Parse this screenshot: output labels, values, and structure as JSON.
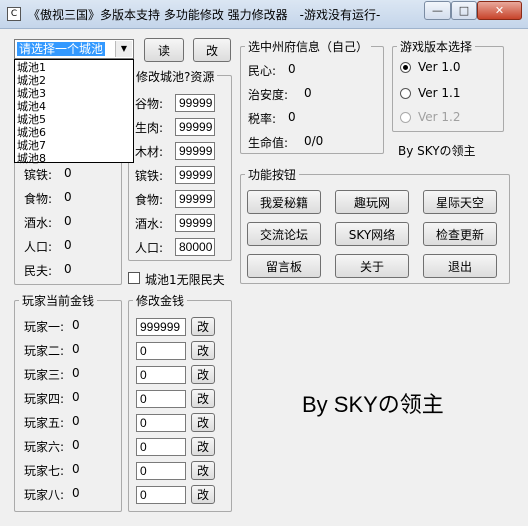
{
  "window": {
    "title": "《傲视三国》多版本支持 多功能修改 强力修改器　-游戏没有运行-",
    "icon_glyph": "C",
    "min": "—",
    "max": "□",
    "close": "✕"
  },
  "city_select": {
    "value": "请选择一个城池",
    "options": [
      "城池1",
      "城池2",
      "城池3",
      "城池4",
      "城池5",
      "城池6",
      "城池7",
      "城池8"
    ]
  },
  "buttons": {
    "read": "读",
    "modify": "改"
  },
  "city_status": {
    "rows": [
      {
        "label": "镔铁:",
        "value": "0"
      },
      {
        "label": "食物:",
        "value": "0"
      },
      {
        "label": "酒水:",
        "value": "0"
      },
      {
        "label": "人口:",
        "value": "0"
      },
      {
        "label": "民夫:",
        "value": "0"
      }
    ]
  },
  "modify_resources": {
    "title": "修改城池?资源",
    "rows": [
      {
        "label": "谷物:",
        "value": "99999"
      },
      {
        "label": "生肉:",
        "value": "99999"
      },
      {
        "label": "木材:",
        "value": "99999"
      },
      {
        "label": "镔铁:",
        "value": "99999"
      },
      {
        "label": "食物:",
        "value": "99999"
      },
      {
        "label": "酒水:",
        "value": "99999"
      },
      {
        "label": "人口:",
        "value": "80000"
      }
    ],
    "unlimited_label": "城池1无限民夫"
  },
  "prefecture": {
    "title": "选中州府信息（自己）",
    "rows": [
      {
        "label": "民心:",
        "value": "0"
      },
      {
        "label": "治安度:",
        "value": "0"
      },
      {
        "label": "税率:",
        "value": "0"
      },
      {
        "label": "生命值:",
        "value": "0/0"
      }
    ]
  },
  "version": {
    "title": "游戏版本选择",
    "options": [
      {
        "label": "Ver 1.0",
        "state": "selected"
      },
      {
        "label": "Ver 1.1",
        "state": "enabled"
      },
      {
        "label": "Ver 1.2",
        "state": "disabled"
      }
    ],
    "credit": "By  SKYの领主"
  },
  "functions": {
    "title": "功能按钮",
    "buttons": [
      "我爱秘籍",
      "趣玩网",
      "星际天空",
      "交流论坛",
      "SKY网络",
      "检查更新",
      "留言板",
      "关于",
      "退出"
    ]
  },
  "player_money": {
    "title": "玩家当前金钱",
    "rows": [
      {
        "label": "玩家一:",
        "value": "0"
      },
      {
        "label": "玩家二:",
        "value": "0"
      },
      {
        "label": "玩家三:",
        "value": "0"
      },
      {
        "label": "玩家四:",
        "value": "0"
      },
      {
        "label": "玩家五:",
        "value": "0"
      },
      {
        "label": "玩家六:",
        "value": "0"
      },
      {
        "label": "玩家七:",
        "value": "0"
      },
      {
        "label": "玩家八:",
        "value": "0"
      }
    ]
  },
  "modify_money": {
    "title": "修改金钱",
    "values": [
      "999999",
      "0",
      "0",
      "0",
      "0",
      "0",
      "0",
      "0"
    ],
    "button_label": "改"
  },
  "big_credit": "By SKYの领主"
}
